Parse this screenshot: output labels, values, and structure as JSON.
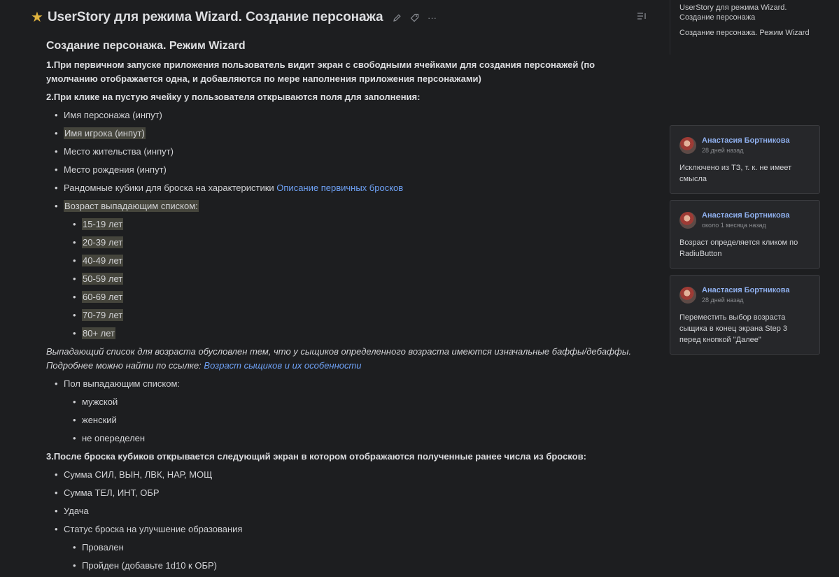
{
  "header": {
    "title": "UserStory для режима Wizard. Создание персонажа",
    "icons": [
      "star-icon",
      "edit-icon",
      "tag-icon",
      "more-icon",
      "toc-icon"
    ]
  },
  "toc": {
    "items": [
      "UserStory для режима Wizard. Создание персонажа",
      "Создание персонажа. Режим Wizard"
    ]
  },
  "content": {
    "heading": "Создание персонажа. Режим Wizard",
    "p1": "1.При первичном запуске приложения пользователь видит экран с свободными ячейками для создания персонажей (по умолчанию отображается одна, и добавляются по мере наполнения приложения персонажами)",
    "p2": "2.При клике на пустую ячейку у пользователя открываются поля для заполнения:",
    "fields": {
      "f1": "Имя персонажа (инпут)",
      "f2": "Имя игрока (инпут)",
      "f3": "Место жительства (инпут)",
      "f4": "Место рождения (инпут)",
      "f5_text": "Рандомные кубики для броска на характеристики",
      "f5_link": "Описание первичных бросков",
      "f6": "Возраст выпадающим списком:"
    },
    "ages": [
      "15-19 лет",
      "20-39 лет",
      "40-49 лет",
      "50-59 лет",
      "60-69 лет",
      "70-79 лет",
      "80+ лет"
    ],
    "note_line1": "Выпадающий список для возраста обусловлен тем, что у сыщиков определенного возраста имеются изначальные баффы/дебаффы.",
    "note_line2": "Подробнее можно найти по ссылке:",
    "note_link": "Возраст сыщиков и их особенности",
    "gender_label": "Пол выпадающим списком:",
    "genders": [
      "мужской",
      "женский",
      "не опеределен"
    ],
    "p3": "3.После броска кубиков открывается следующий экран в котором отображаются полученные ранее числа из бросков:",
    "results": [
      "Сумма СИЛ, ВЫН, ЛВК, НАР, МОЩ",
      "Сумма ТЕЛ, ИНТ, ОБР",
      "Удача",
      "Статус броска на улучшение образования"
    ],
    "edu": [
      "Провален",
      "Пройден (добавьте 1d10 к ОБР)"
    ]
  },
  "comments": [
    {
      "author": "Анастасия Бортникова",
      "time": "28 дней назад",
      "text": "Исключено из ТЗ, т. к. не имеет смысла"
    },
    {
      "author": "Анастасия Бортникова",
      "time": "около 1 месяца назад",
      "text": "Возраст определяется кликом по RadiuButton"
    },
    {
      "author": "Анастасия Бортникова",
      "time": "28 дней назад",
      "text": "Переместить выбор возраста сыщика в конец экрана Step 3 перед кнопкой \"Далее\""
    }
  ]
}
